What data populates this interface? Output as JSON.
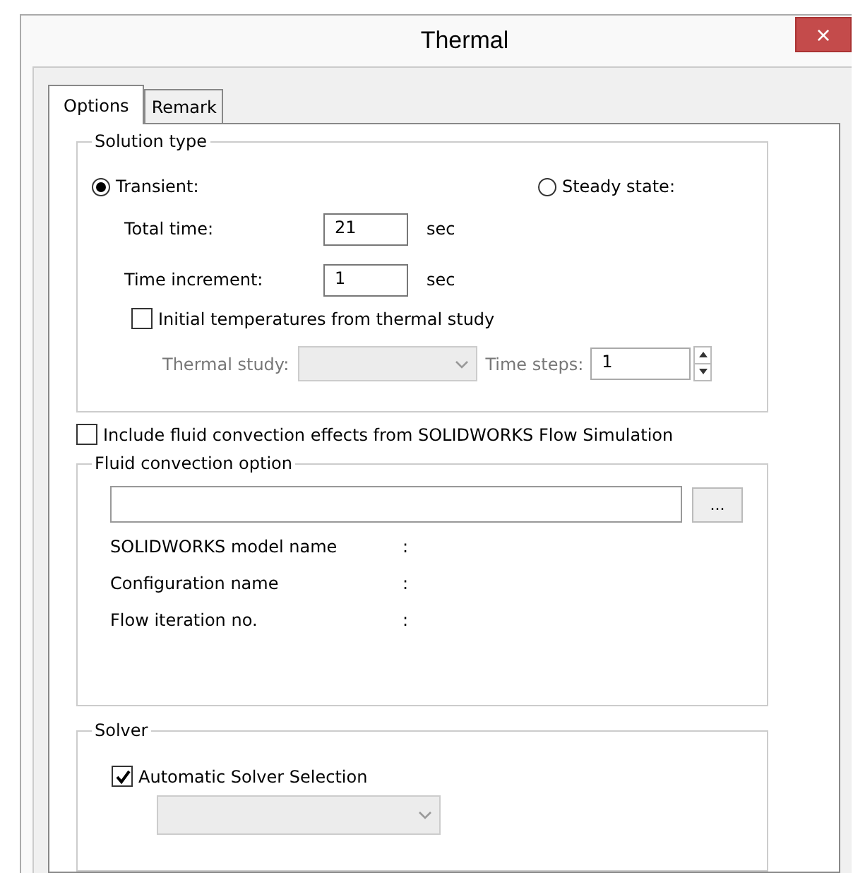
{
  "window": {
    "title": "Thermal",
    "close": "×"
  },
  "tabs": [
    {
      "label": "Options",
      "selected": true
    },
    {
      "label": "Remark",
      "selected": false
    }
  ],
  "solution_type": {
    "title": "Solution type",
    "options": [
      {
        "label": "Transient:",
        "selected": true
      },
      {
        "label": "Steady state:",
        "selected": false
      }
    ],
    "fields": [
      {
        "label": "Total time:",
        "value": "21",
        "unit": "sec"
      },
      {
        "label": "Time increment:",
        "value": "1",
        "unit": "sec"
      }
    ],
    "initial_temperatures": {
      "label": "Initial temperatures from thermal study",
      "checked": false
    },
    "thermal_study": {
      "label": "Thermal study:",
      "disabled": true
    },
    "time_steps": {
      "label": "Time steps:",
      "value": "1",
      "disabled": true
    }
  },
  "fluid_convection_checkbox": {
    "label": "Include fluid convection effects from SOLIDWORKS Flow Simulation",
    "checked": false
  },
  "fluid_convection_option": {
    "title": "Fluid convection option",
    "browse_button": "...",
    "info_rows": [
      {
        "label": "SOLIDWORKS model name",
        "separator": ":"
      },
      {
        "label": "Configuration name",
        "separator": ":"
      },
      {
        "label": "Flow iteration no.",
        "separator": ":"
      }
    ]
  },
  "solver": {
    "title": "Solver",
    "auto_selection": {
      "label": "Automatic Solver Selection",
      "checked": true
    },
    "solver_dropdown": {
      "disabled": true
    }
  }
}
